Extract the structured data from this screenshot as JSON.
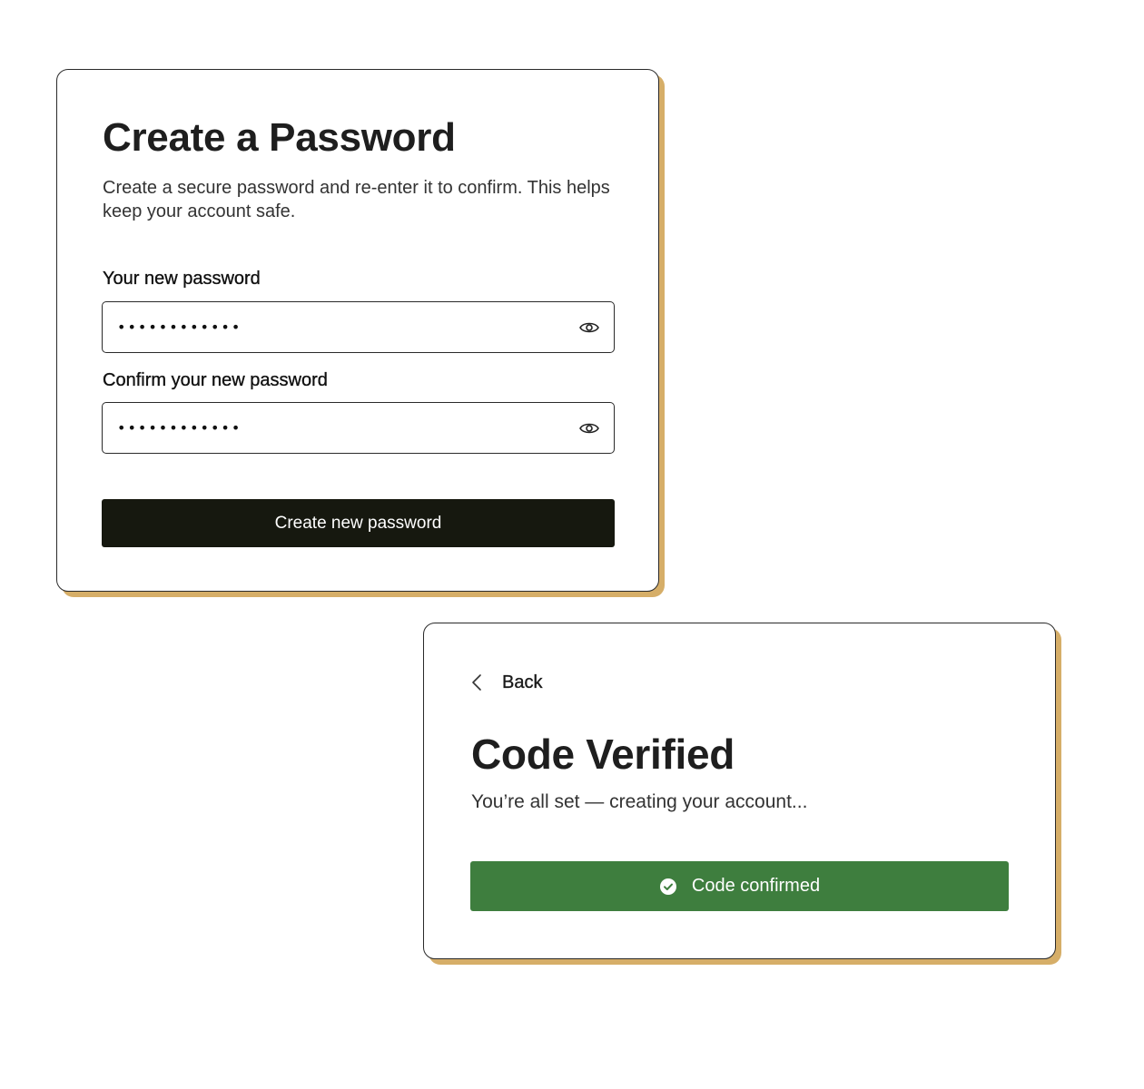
{
  "password_card": {
    "title": "Create a Password",
    "subtitle": "Create a secure password and re-enter it to confirm. This helps keep your account safe.",
    "new_password": {
      "label": "Your new password",
      "value": "••••••••••••",
      "toggle_icon": "eye-icon"
    },
    "confirm_password": {
      "label": "Confirm your new password",
      "value": "••••••••••••",
      "toggle_icon": "eye-icon"
    },
    "submit_label": "Create new password",
    "submit_color": "#16180f"
  },
  "verified_card": {
    "back_label": "Back",
    "back_icon": "chevron-left-icon",
    "title": "Code Verified",
    "subtitle": "You’re all set — creating your account...",
    "status_button": {
      "label": "Code confirmed",
      "icon": "check-circle-icon",
      "color": "#3e7e3e"
    }
  },
  "theme": {
    "card_shadow": "#d6ae68",
    "border": "#2a2a2a"
  }
}
